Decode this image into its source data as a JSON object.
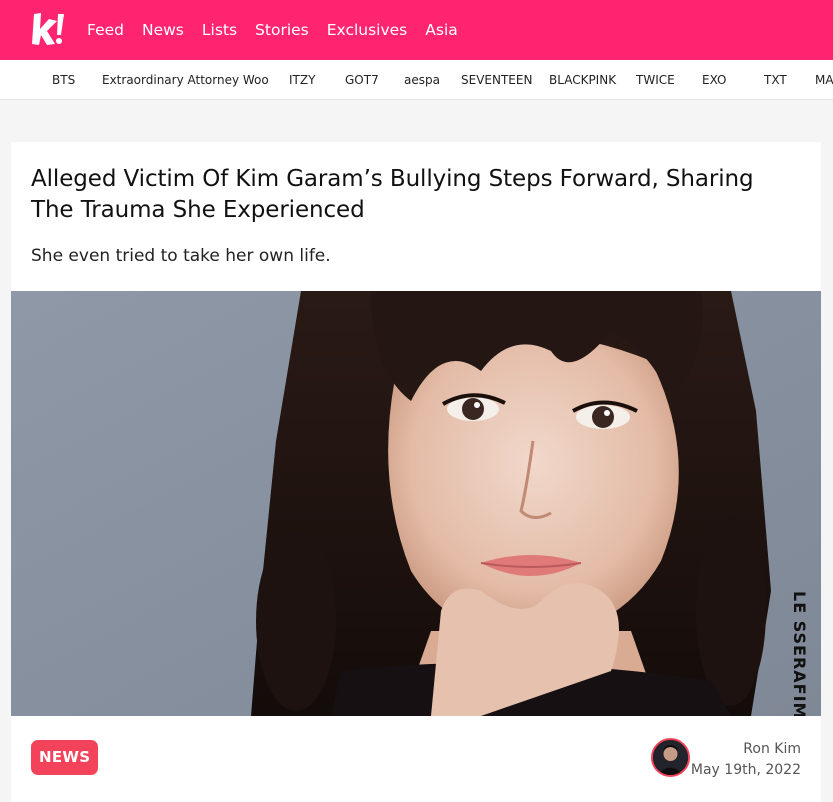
{
  "nav": {
    "logo": "k!",
    "items": [
      "Feed",
      "News",
      "Lists",
      "Stories",
      "Exclusives",
      "Asia"
    ]
  },
  "tags": [
    "BTS",
    "Extraordinary Attorney Woo",
    "ITZY",
    "GOT7",
    "aespa",
    "SEVENTEEN",
    "BLACKPINK",
    "TWICE",
    "EXO",
    "TXT",
    "MA"
  ],
  "article": {
    "title_line1": "Alleged Victim Of Kim Garam’s Bullying Steps Forward, Sharing",
    "title_line2": "The Trauma She Experienced",
    "subtitle": "She even tried to take her own life.",
    "image_watermark": "LE SSERAFIM",
    "category": "NEWS",
    "author": "Ron Kim",
    "date": "May 19th, 2022"
  },
  "colors": {
    "brand": "#fe2470",
    "badge": "#f2435a"
  },
  "icons": {
    "logo": "koreaboo-logo-icon"
  }
}
